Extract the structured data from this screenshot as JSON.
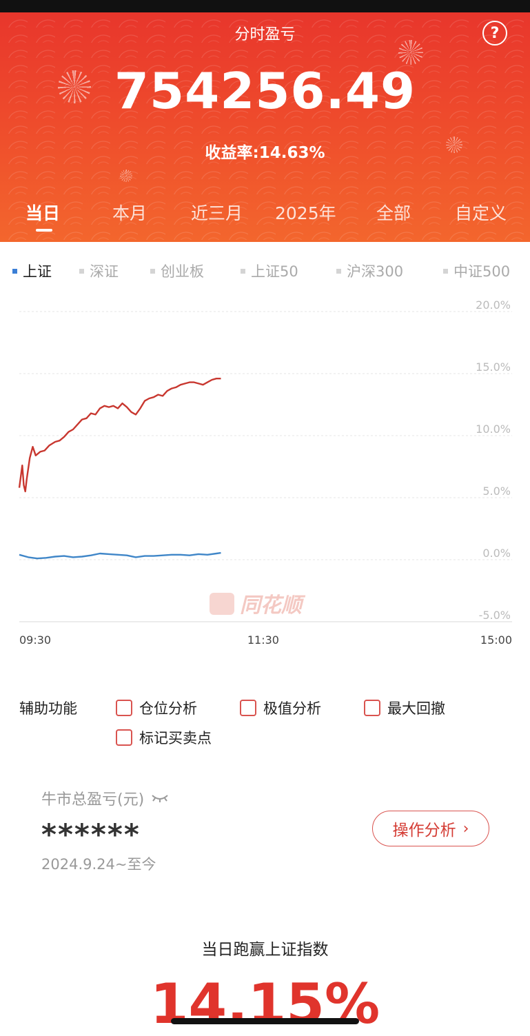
{
  "header": {
    "title": "分时盈亏",
    "help_icon": "question-circle-icon",
    "amount": "754256.49",
    "rate_label": "收益率:",
    "rate_value": "14.63%",
    "background": "#ee4a2c"
  },
  "period_tabs": [
    {
      "label": "当日",
      "active": true
    },
    {
      "label": "本月",
      "active": false
    },
    {
      "label": "近三月",
      "active": false
    },
    {
      "label": "2025年",
      "active": false
    },
    {
      "label": "全部",
      "active": false
    },
    {
      "label": "自定义",
      "active": false
    }
  ],
  "index_tabs": [
    {
      "label": "上证",
      "active": true
    },
    {
      "label": "深证",
      "active": false
    },
    {
      "label": "创业板",
      "active": false
    },
    {
      "label": "上证50",
      "active": false
    },
    {
      "label": "沪深300",
      "active": false
    },
    {
      "label": "中证500",
      "active": false
    }
  ],
  "chart_data": {
    "type": "line",
    "y_ticks": [
      "20.0%",
      "15.0%",
      "10.0%",
      "5.0%",
      "0.0%",
      "-5.0%"
    ],
    "ylim": [
      -5,
      20
    ],
    "x_ticks": [
      "09:30",
      "11:30",
      "15:00"
    ],
    "grid": true,
    "watermark": "同花顺",
    "series": [
      {
        "color": "#c8372f",
        "points": [
          [
            0,
            5.8
          ],
          [
            2,
            7.6
          ],
          [
            3,
            6.0
          ],
          [
            4,
            5.5
          ],
          [
            5,
            6.5
          ],
          [
            7,
            8.2
          ],
          [
            9,
            9.1
          ],
          [
            11,
            8.4
          ],
          [
            14,
            8.7
          ],
          [
            17,
            8.8
          ],
          [
            20,
            9.2
          ],
          [
            24,
            9.5
          ],
          [
            27,
            9.6
          ],
          [
            30,
            9.9
          ],
          [
            33,
            10.3
          ],
          [
            36,
            10.5
          ],
          [
            39,
            10.9
          ],
          [
            42,
            11.3
          ],
          [
            45,
            11.4
          ],
          [
            48,
            11.8
          ],
          [
            51,
            11.7
          ],
          [
            54,
            12.2
          ],
          [
            57,
            12.4
          ],
          [
            60,
            12.3
          ],
          [
            63,
            12.4
          ],
          [
            66,
            12.2
          ],
          [
            69,
            12.6
          ],
          [
            72,
            12.3
          ],
          [
            75,
            11.9
          ],
          [
            78,
            11.7
          ],
          [
            81,
            12.2
          ],
          [
            84,
            12.8
          ],
          [
            87,
            13.0
          ],
          [
            90,
            13.1
          ],
          [
            93,
            13.3
          ],
          [
            96,
            13.2
          ],
          [
            99,
            13.6
          ],
          [
            102,
            13.8
          ],
          [
            105,
            13.9
          ],
          [
            108,
            14.1
          ],
          [
            111,
            14.2
          ],
          [
            114,
            14.3
          ],
          [
            117,
            14.3
          ],
          [
            120,
            14.2
          ],
          [
            123,
            14.1
          ],
          [
            126,
            14.3
          ],
          [
            129,
            14.5
          ],
          [
            132,
            14.6
          ],
          [
            135,
            14.6
          ]
        ]
      },
      {
        "color": "#3f86c8",
        "points": [
          [
            0,
            0.4
          ],
          [
            6,
            0.2
          ],
          [
            12,
            0.1
          ],
          [
            18,
            0.15
          ],
          [
            24,
            0.25
          ],
          [
            30,
            0.3
          ],
          [
            36,
            0.2
          ],
          [
            42,
            0.25
          ],
          [
            48,
            0.35
          ],
          [
            54,
            0.5
          ],
          [
            60,
            0.45
          ],
          [
            66,
            0.4
          ],
          [
            72,
            0.35
          ],
          [
            78,
            0.2
          ],
          [
            84,
            0.3
          ],
          [
            90,
            0.3
          ],
          [
            96,
            0.35
          ],
          [
            102,
            0.4
          ],
          [
            108,
            0.4
          ],
          [
            114,
            0.35
          ],
          [
            120,
            0.45
          ],
          [
            126,
            0.4
          ],
          [
            132,
            0.5
          ],
          [
            135,
            0.55
          ]
        ]
      }
    ],
    "x_range_minutes": [
      0,
      330
    ]
  },
  "aux": {
    "title": "辅助功能",
    "options": [
      "仓位分析",
      "极值分析",
      "最大回撤",
      "标记买卖点"
    ]
  },
  "bull": {
    "label": "牛市总盈亏(元)",
    "eye_icon": "eye-closed-icon",
    "value": "******",
    "date": "2024.9.24~至今",
    "button": "操作分析",
    "chevron": "›"
  },
  "beat": {
    "title": "当日跑赢上证指数",
    "value": "14.15%"
  }
}
